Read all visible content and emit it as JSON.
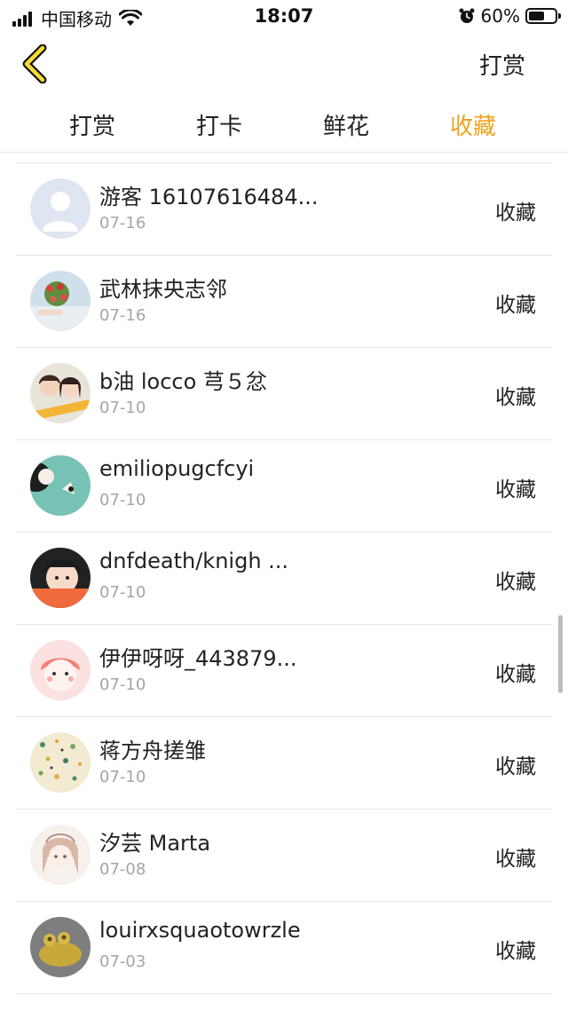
{
  "status_bar": {
    "carrier": "中国移动",
    "time": "18:07",
    "battery_percent": "60%",
    "battery_level": 0.6,
    "icons": [
      "signal-icon",
      "wifi-icon",
      "alarm-icon",
      "battery-icon"
    ]
  },
  "nav": {
    "back_icon": "chevron-left-icon",
    "action_label": "打赏",
    "accent_color": "#f0a21b"
  },
  "tabs": [
    {
      "label": "打赏",
      "active": false
    },
    {
      "label": "打卡",
      "active": false
    },
    {
      "label": "鲜花",
      "active": false
    },
    {
      "label": "收藏",
      "active": true
    }
  ],
  "list": {
    "items": [
      {
        "name": "游客 16107616484...",
        "date": "07-16",
        "action": "收藏",
        "avatar": "default-user-avatar"
      },
      {
        "name": "武林抹央志邻",
        "date": "07-16",
        "action": "收藏",
        "avatar": "flowers-photo-avatar"
      },
      {
        "name": "b油 locco 芎５忿",
        "date": "07-10",
        "action": "收藏",
        "avatar": "couple-photo-avatar"
      },
      {
        "name": "emiliopugcfcyi",
        "date": "07-10",
        "action": "收藏",
        "avatar": "illustration-avatar"
      },
      {
        "name": "dnfdeath/knigh ...",
        "date": "07-10",
        "action": "收藏",
        "avatar": "child-photo-avatar"
      },
      {
        "name": "伊伊呀呀_443879...",
        "date": "07-10",
        "action": "收藏",
        "avatar": "cartoon-face-avatar"
      },
      {
        "name": "蒋方舟搓雏",
        "date": "07-10",
        "action": "收藏",
        "avatar": "terrazzo-pattern-avatar"
      },
      {
        "name": "汐芸 Marta",
        "date": "07-08",
        "action": "收藏",
        "avatar": "anime-girl-avatar"
      },
      {
        "name": "louirxsquaotowrzle",
        "date": "07-03",
        "action": "收藏",
        "avatar": "golden-frog-avatar"
      }
    ]
  }
}
